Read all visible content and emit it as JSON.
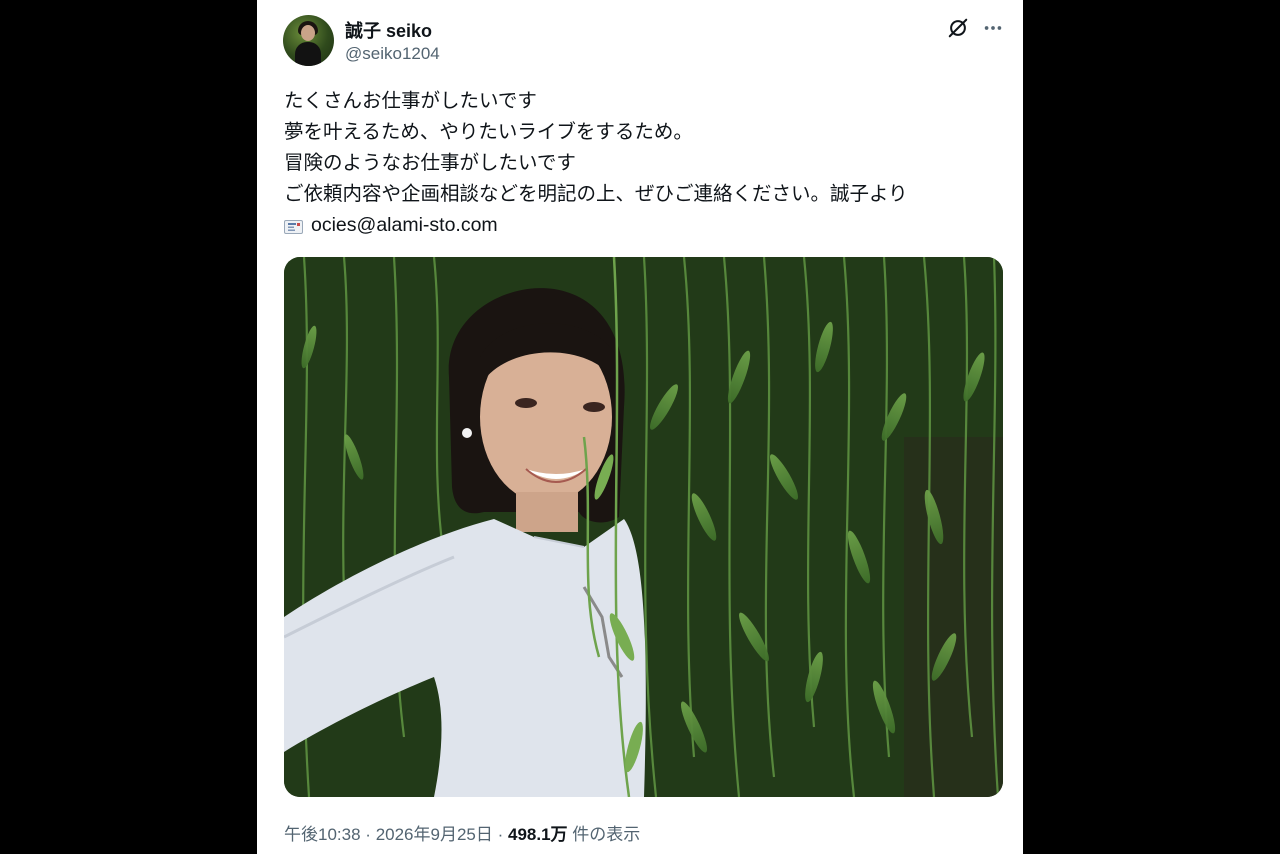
{
  "tweet": {
    "display_name": "誠子 seiko",
    "handle": "@seiko1204",
    "lines": [
      "たくさんお仕事がしたいです",
      "夢を叶えるため、やりたいライブをするため。",
      "冒険のようなお仕事がしたいです",
      "ご依頼内容や企画相談などを明記の上、ぜひご連絡ください。誠子より"
    ],
    "email": "ocies@alami-sto.com",
    "time": "午後10:38",
    "separator": "·",
    "date": "2026年9月25日",
    "views_count": "498.1万",
    "views_label": "件の表示"
  },
  "icons": {
    "grok": "grok-icon",
    "more": "more-options-icon",
    "mail": "envelope-icon"
  },
  "colors": {
    "text_primary": "#0f1419",
    "text_secondary": "#536471",
    "background": "#000000",
    "card": "#ffffff"
  }
}
